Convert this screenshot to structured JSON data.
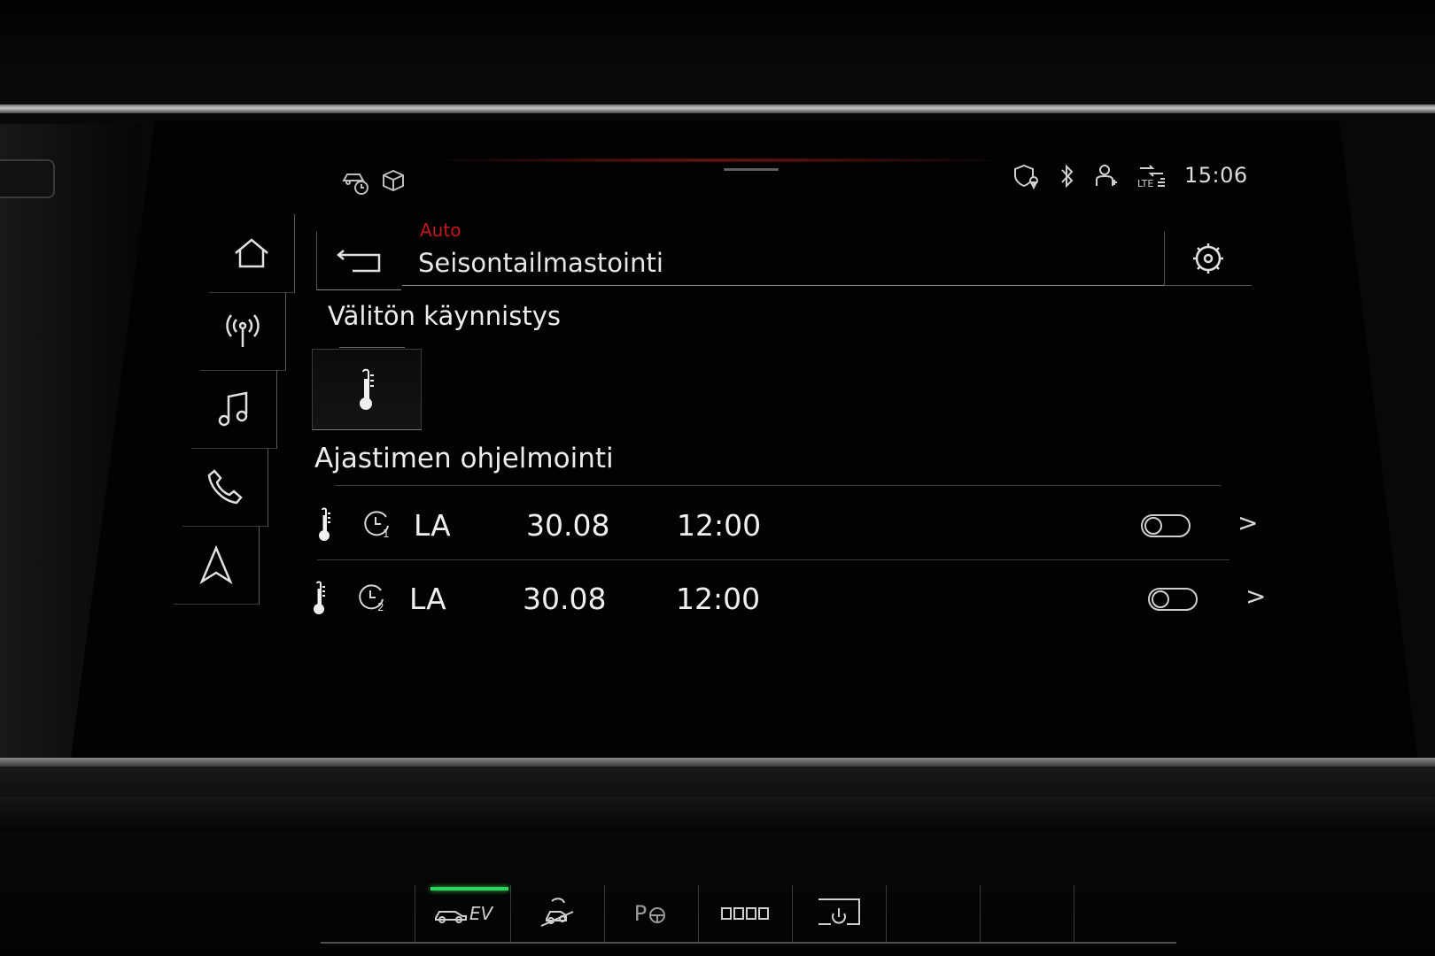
{
  "status_bar": {
    "time": "15:06",
    "icons": [
      "driver-assist-icon",
      "package-icon",
      "location-shield-icon",
      "bluetooth-icon",
      "user-profile-icon",
      "lte-signal-icon"
    ]
  },
  "sidebar": {
    "items": [
      {
        "icon": "home-icon"
      },
      {
        "icon": "radio-icon"
      },
      {
        "icon": "music-icon"
      },
      {
        "icon": "phone-icon"
      },
      {
        "icon": "navigation-icon"
      }
    ]
  },
  "header": {
    "breadcrumb": "Auto",
    "title": "Seisontailmastointi",
    "back_icon": "back-arrow-icon",
    "settings_icon": "settings-gear-icon"
  },
  "instant_start": {
    "heading": "Välitön käynnistys",
    "icon": "thermometer-icon"
  },
  "timer_programming": {
    "heading": "Ajastimen ohjelmointi",
    "timers": [
      {
        "timer_number": "1",
        "day": "LA",
        "date": "30.08",
        "time": "12:00",
        "enabled": false
      },
      {
        "timer_number": "2",
        "day": "LA",
        "date": "30.08",
        "time": "12:00",
        "enabled": false
      }
    ]
  },
  "console": {
    "ev_label": "EV",
    "ev_active": true,
    "parking_label": "P",
    "colors": {
      "ev_indicator": "#33d35a",
      "breadcrumb_red": "#c4161c"
    }
  }
}
